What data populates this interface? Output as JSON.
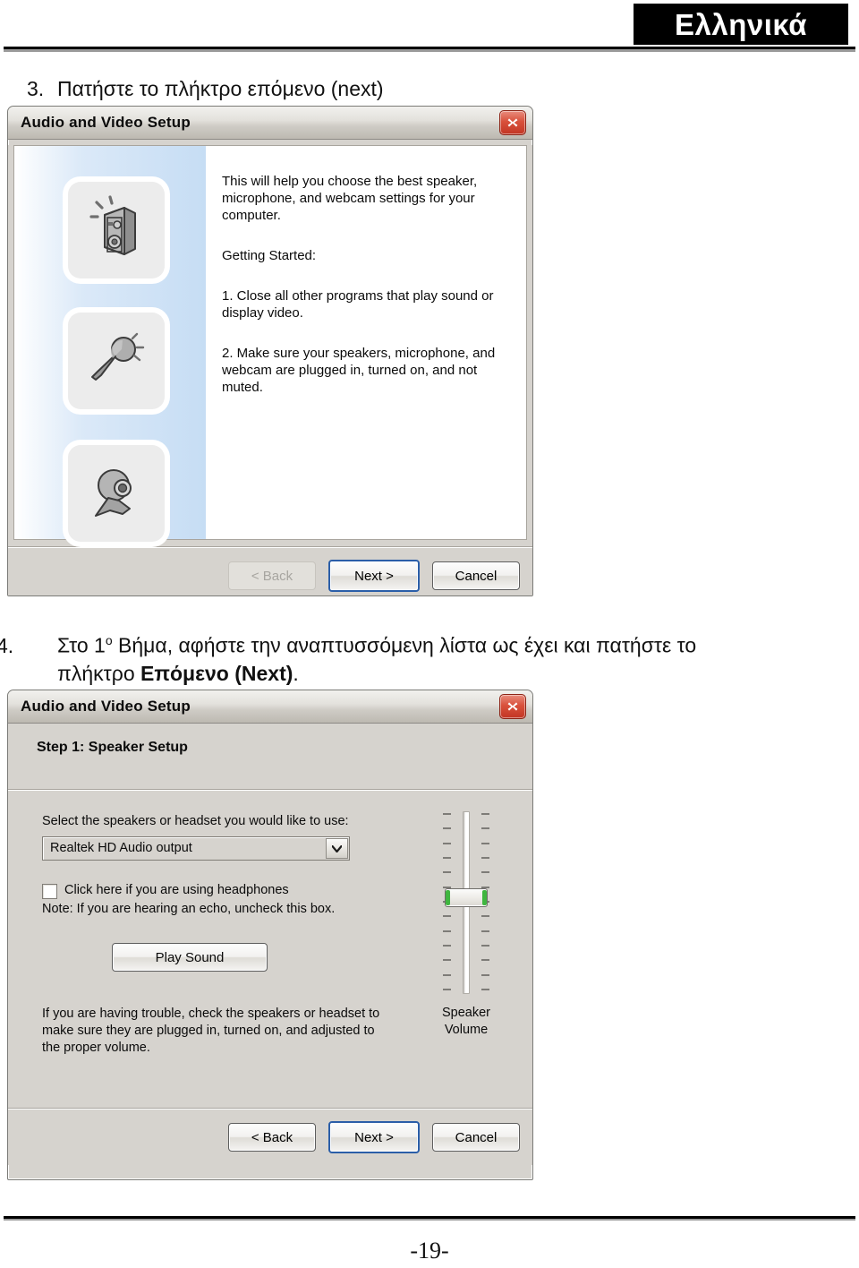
{
  "header": {
    "language_band": "Ελληνικά"
  },
  "steps": {
    "step3": {
      "number": "3.",
      "text": "Πατήστε το πλήκτρο επόμενο (next)"
    },
    "step4": {
      "number": "4.",
      "line1_a": "Στο 1",
      "line1_sup": "ο",
      "line1_b": " Βήμα, αφήστε την αναπτυσσόμενη λίστα ως έχει και πατήστε το",
      "line2_a": "πλήκτρο ",
      "line2_bold": "Επόμενο (Next)",
      "line2_b": "."
    }
  },
  "dialog1": {
    "title": "Audio and Video Setup",
    "close_icon": "close-icon",
    "icons": [
      {
        "name": "speaker-icon",
        "label": "Speaker"
      },
      {
        "name": "microphone-icon",
        "label": "Microphone"
      },
      {
        "name": "webcam-icon",
        "label": "Webcam"
      }
    ],
    "paragraphs": {
      "intro": "This will help you choose the best speaker, microphone, and webcam settings for your computer.",
      "getting_started": "Getting Started:",
      "item1": "1. Close all other programs that play sound or display video.",
      "item2": "2. Make sure your speakers, microphone, and webcam are plugged in, turned on, and not muted."
    },
    "buttons": {
      "back": "< Back",
      "next": "Next >",
      "cancel": "Cancel"
    }
  },
  "dialog2": {
    "title": "Audio and Video Setup",
    "close_icon": "close-icon",
    "step_header": "Step 1: Speaker Setup",
    "speaker_label": "Select the speakers or headset you would like to use:",
    "speaker_select": {
      "value": "Realtek HD Audio output",
      "arrow_icon": "chevron-down-icon"
    },
    "headphones_checkbox": {
      "label": "Click here if you are using headphones",
      "checked": false
    },
    "note": "Note: If you are hearing an echo, uncheck this box.",
    "play_sound_button": "Play Sound",
    "troubleshoot": "If you are having trouble, check the speakers or headset to make sure they are plugged in, turned on, and adjusted to the proper volume.",
    "volume": {
      "label_line1": "Speaker",
      "label_line2": "Volume",
      "ticks": 13,
      "thumb_position_percent": 52,
      "accent_color": "#3fb63f"
    },
    "buttons": {
      "back": "< Back",
      "next": "Next >",
      "cancel": "Cancel"
    }
  },
  "footer": {
    "page_number": "-19-"
  }
}
